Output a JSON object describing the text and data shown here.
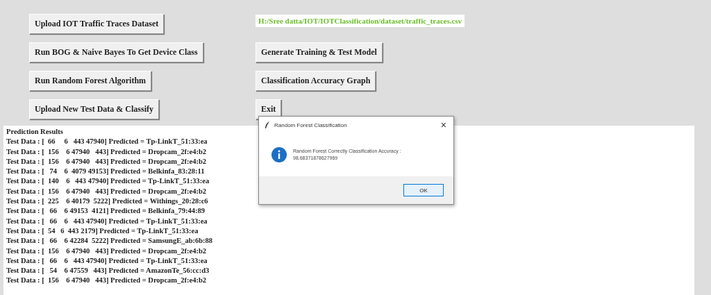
{
  "left_buttons": [
    "Upload IOT Traffic Traces Dataset",
    "Run BOG & Naive Bayes To Get Device Class",
    "Run Random Forest Algorithm",
    "Upload New Test Data & Classify"
  ],
  "right_buttons": [
    "Generate Training & Test Model",
    "Classification Accuracy Graph",
    "Exit"
  ],
  "path_label": "H:/Sree datta/IOT/IOTClassification/dataset/traffic_traces.csv",
  "results": {
    "heading": "Prediction Results",
    "lines": [
      "Test Data : [  66     6   443 47940] Predicted = Tp-LinkT_51:33:ea",
      "Test Data : [  156    6 47940   443] Predicted = Dropcam_2f:e4:b2",
      "Test Data : [  156    6 47940   443] Predicted = Dropcam_2f:e4:b2",
      "Test Data : [   74    6  4079 49153] Predicted = Belkinfa_83:28:11",
      "Test Data : [  140    6   443 47940] Predicted = Tp-LinkT_51:33:ea",
      "Test Data : [  156    6 47940   443] Predicted = Dropcam_2f:e4:b2",
      "Test Data : [  225    6 40179  5222] Predicted = Withings_20:28:c6",
      "Test Data : [   66    6 49153  4121] Predicted = Belkinfa_79:44:89",
      "Test Data : [   66    6   443 47940] Predicted = Tp-LinkT_51:33:ea",
      "Test Data : [  54   6  443 2179] Predicted = Tp-LinkT_51:33:ea",
      "Test Data : [   66    6 42284  5222] Predicted = SamsungE_ab:6b:88",
      "Test Data : [  156    6 47940   443] Predicted = Dropcam_2f:e4:b2",
      "Test Data : [   66    6   443 47940] Predicted = Tp-LinkT_51:33:ea",
      "Test Data : [   54    6 47559   443] Predicted = AmazonTe_56:cc:d3",
      "Test Data : [  156    6 47940   443] Predicted = Dropcam_2f:e4:b2"
    ]
  },
  "dialog": {
    "title": "Random Forest Classification",
    "close": "×",
    "message": "Random Forest Correctly Classification Accuracy : 98.68371878627969",
    "ok": "OK"
  }
}
